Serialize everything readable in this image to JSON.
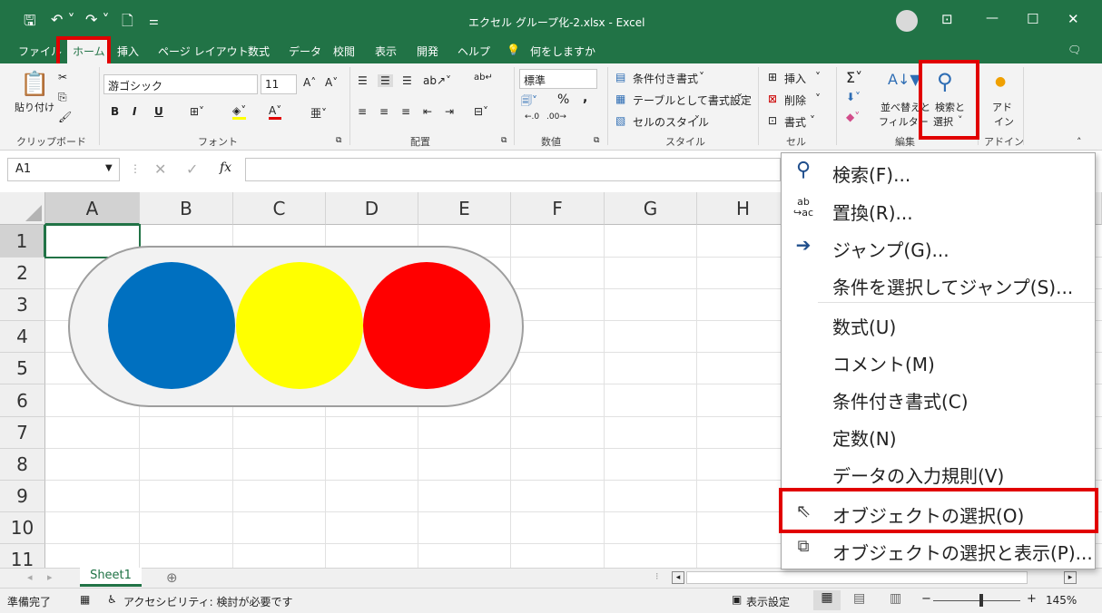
{
  "window": {
    "title": "エクセル グループ化-2.xlsx  -  Excel",
    "controls": {
      "minimize": "—",
      "maximize": "☐",
      "close": "✕",
      "ribbon_display": "⊡"
    }
  },
  "tabs": [
    "ファイル",
    "ホーム",
    "挿入",
    "ページ レイアウト",
    "数式",
    "データ",
    "校閲",
    "表示",
    "開発",
    "ヘルプ"
  ],
  "tell_me": "何をしますか",
  "ribbon": {
    "clipboard": {
      "paste": "貼り付け",
      "group": "クリップボード"
    },
    "font": {
      "name": "游ゴシック",
      "size": "11",
      "bold": "B",
      "italic": "I",
      "underline": "U",
      "group": "フォント"
    },
    "alignment": {
      "group": "配置"
    },
    "number": {
      "format": "標準",
      "percent": "%",
      "comma": ",",
      "group": "数値"
    },
    "styles": {
      "conditional": "条件付き書式",
      "as_table": "テーブルとして書式設定",
      "cell_styles": "セルのスタイル",
      "group": "スタイル"
    },
    "cells": {
      "insert": "挿入",
      "delete": "削除",
      "format": "書式",
      "group": "セル"
    },
    "editing": {
      "sort_filter_1": "並べ替えと",
      "sort_filter_2": "フィルター",
      "find_select_1": "検索と",
      "find_select_2": "選択",
      "group": "編集"
    },
    "addins": {
      "label_1": "アド",
      "label_2": "イン",
      "group": "アドイン"
    }
  },
  "formula_bar": {
    "name_box": "A1",
    "fx": "fx",
    "value": ""
  },
  "columns": [
    "A",
    "B",
    "C",
    "D",
    "E",
    "F",
    "G",
    "H"
  ],
  "rows": [
    "1",
    "2",
    "3",
    "4",
    "5",
    "6",
    "7",
    "8",
    "9",
    "10",
    "11"
  ],
  "shape": {
    "colors": {
      "blue": "#0070C0",
      "yellow": "#FFFF00",
      "red": "#FF0000",
      "body": "#F2F2F2"
    }
  },
  "menu": {
    "items": [
      {
        "label": "検索(F)...",
        "key": "F",
        "icon": "search-icon"
      },
      {
        "label": "置換(R)...",
        "key": "R",
        "icon": "replace-icon"
      },
      {
        "label": "ジャンプ(G)...",
        "key": "G",
        "icon": "arrow-right-icon"
      },
      {
        "label": "条件を選択してジャンプ(S)...",
        "key": "S",
        "icon": ""
      },
      {
        "label": "数式(U)",
        "key": "U",
        "icon": ""
      },
      {
        "label": "コメント(M)",
        "key": "M",
        "icon": ""
      },
      {
        "label": "条件付き書式(C)",
        "key": "C",
        "icon": ""
      },
      {
        "label": "定数(N)",
        "key": "N",
        "icon": ""
      },
      {
        "label": "データの入力規則(V)",
        "key": "V",
        "icon": ""
      },
      {
        "label": "オブジェクトの選択(O)",
        "key": "O",
        "icon": "cursor-icon"
      },
      {
        "label": "オブジェクトの選択と表示(P)...",
        "key": "P",
        "icon": "selection-pane-icon"
      }
    ]
  },
  "sheet": {
    "tab": "Sheet1",
    "add": "⊕"
  },
  "status": {
    "ready": "準備完了",
    "accessibility": "アクセシビリティ: 検討が必要です",
    "display_settings": "表示設定",
    "zoom": "145%",
    "zoom_minus": "−",
    "zoom_plus": "+"
  },
  "colors": {
    "excel_green": "#217346",
    "highlight_red": "#E10000"
  }
}
